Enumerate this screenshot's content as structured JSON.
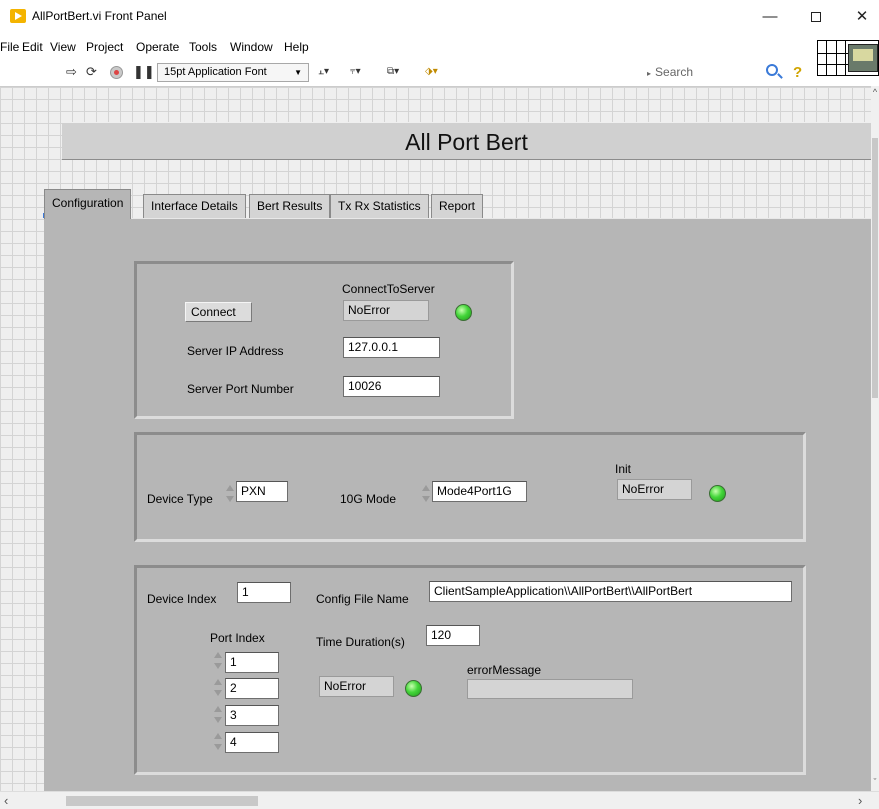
{
  "window": {
    "title": "AllPortBert.vi Front Panel",
    "minimize": "—",
    "close": "✕"
  },
  "menu": [
    "File",
    "Edit",
    "View",
    "Project",
    "Operate",
    "Tools",
    "Window",
    "Help"
  ],
  "toolbar": {
    "font": "15pt Application Font",
    "search_placeholder": "Search"
  },
  "panel": {
    "title": "All Port Bert"
  },
  "tabs": [
    "Configuration",
    "Interface Details",
    "Bert Results",
    "Tx Rx Statistics",
    "Report"
  ],
  "active_tab": "Configuration",
  "server": {
    "connect_label": "Connect",
    "connect_status_label": "ConnectToServer",
    "connect_status": "NoError",
    "ip_label": "Server IP Address",
    "ip": "127.0.0.1",
    "port_label": "Server Port  Number",
    "port": "10026"
  },
  "device": {
    "type_label": "Device Type",
    "type": "PXN",
    "mode_label": "10G Mode",
    "mode": "Mode4Port1G",
    "init_label": "Init",
    "init_status": "NoError"
  },
  "config": {
    "device_index_label": "Device Index",
    "device_index": "1",
    "config_file_label": "Config File Name",
    "config_file": "ClientSampleApplication\\\\AllPortBert\\\\AllPortBert",
    "port_index_label": "Port Index",
    "ports": [
      "1",
      "2",
      "3",
      "4"
    ],
    "duration_label": "Time Duration(s)",
    "duration": "120",
    "status": "NoError",
    "error_label": "errorMessage",
    "error_message": ""
  }
}
